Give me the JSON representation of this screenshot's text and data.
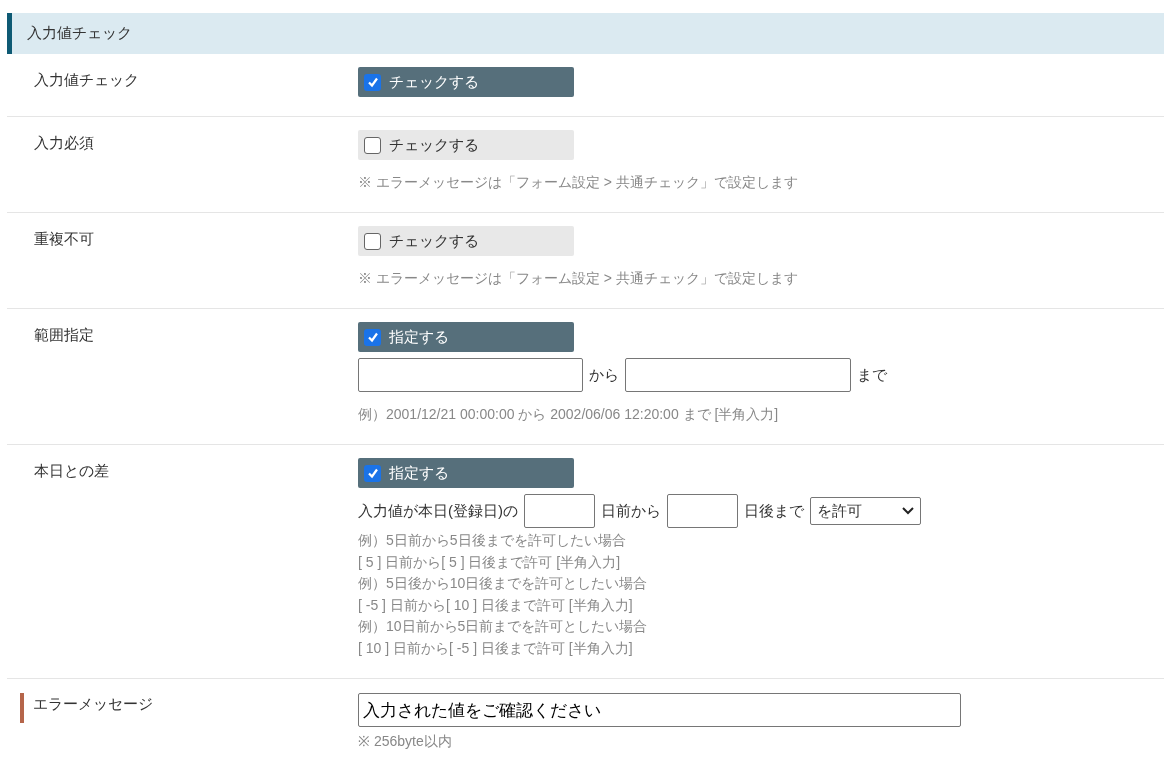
{
  "section": {
    "title": "入力値チェック"
  },
  "rows": [
    {
      "kind": "checkbox",
      "label": "入力値チェック",
      "checkbox": {
        "label": "チェックする",
        "checked": true
      }
    },
    {
      "kind": "checkbox",
      "label": "入力必須",
      "checkbox": {
        "label": "チェックする",
        "checked": false
      },
      "note": "※ エラーメッセージは「フォーム設定 > 共通チェック」で設定します"
    },
    {
      "kind": "checkbox",
      "label": "重複不可",
      "checkbox": {
        "label": "チェックする",
        "checked": false
      },
      "note": "※ エラーメッセージは「フォーム設定 > 共通チェック」で設定します"
    },
    {
      "kind": "range",
      "label": "範囲指定",
      "checkbox": {
        "label": "指定する",
        "checked": true
      },
      "between": "から",
      "after": "まで",
      "note": "例）2001/12/21 00:00:00 から 2002/06/06 12:20:00 まで [半角入力]"
    },
    {
      "kind": "days",
      "label": "本日との差",
      "checkbox": {
        "label": "指定する",
        "checked": true
      },
      "prefix": "入力値が本日(登録日)の",
      "between": "日前から",
      "after": "日後まで",
      "select": {
        "value": "を許可"
      },
      "examples": [
        "例）5日前から5日後までを許可したい場合",
        "[ 5 ] 日前から[ 5 ] 日後まで許可 [半角入力]",
        "例）5日後から10日後までを許可としたい場合",
        "[ -5 ] 日前から[ 10 ] 日後まで許可 [半角入力]",
        "例）10日前から5日前までを許可としたい場合",
        "[ 10 ] 日前から[ -5 ] 日後まで許可 [半角入力]"
      ]
    },
    {
      "kind": "text",
      "label": "エラーメッセージ",
      "required": true,
      "value": "入力された値をご確認ください",
      "note": "※ 256byte以内"
    }
  ]
}
